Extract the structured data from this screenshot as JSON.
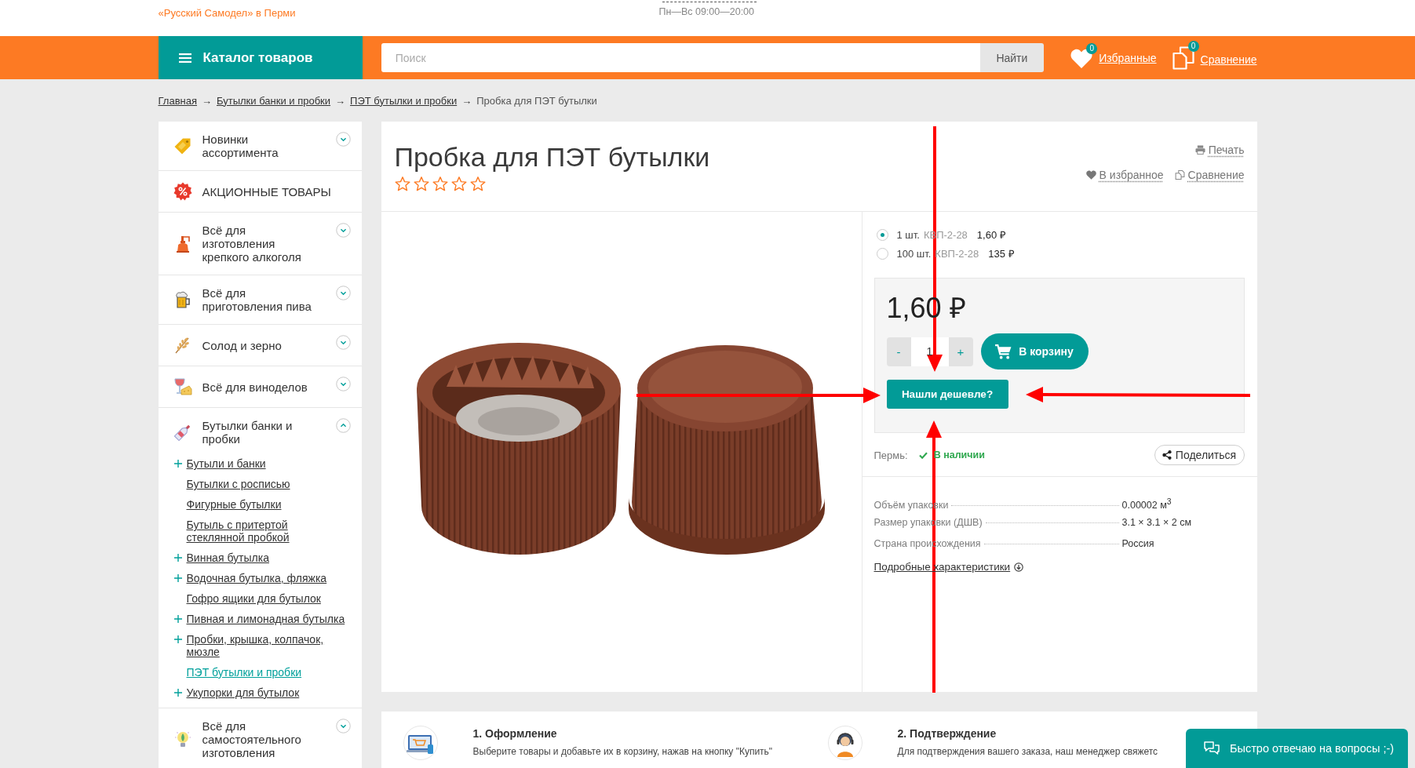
{
  "header": {
    "tagline": "«Русский Самодел» в Перми",
    "hours": "Пн—Вс 09:00—20:00"
  },
  "navbar": {
    "catalog_button": "Каталог товаров",
    "search": {
      "placeholder": "Поиск",
      "button": "Найти"
    },
    "favorites": {
      "label": "Избранные",
      "count": "0"
    },
    "compare": {
      "label": "Сравнение",
      "count": "0"
    }
  },
  "breadcrumb": [
    {
      "label": "Главная",
      "kind": "link",
      "separator": "→"
    },
    {
      "label": "Бутылки банки и пробки",
      "kind": "link",
      "separator": "→"
    },
    {
      "label": "ПЭТ бутылки и пробки",
      "kind": "link",
      "separator": "→"
    },
    {
      "label": "Пробка для ПЭТ бутылки",
      "kind": "current"
    }
  ],
  "sidebar": {
    "items": [
      {
        "label": "Новинки ассортимента",
        "kind": "category",
        "expanded": false
      },
      {
        "label": "АКЦИОННЫЕ ТОВАРЫ",
        "kind": "promo"
      },
      {
        "label": "Всё для изготовления крепкого алкоголя",
        "kind": "category",
        "expanded": false
      },
      {
        "label": "Всё для приготовления пива",
        "kind": "category",
        "expanded": false
      },
      {
        "label": "Солод и зерно",
        "kind": "category",
        "expanded": false
      },
      {
        "label": "Всё для виноделов",
        "kind": "category",
        "expanded": false
      },
      {
        "label": "Бутылки банки и пробки",
        "kind": "category",
        "expanded": true,
        "children": [
          {
            "label": "Бутыли и банки",
            "has_children": true,
            "selected": false
          },
          {
            "label": "Бутылки с росписью",
            "has_children": false,
            "selected": false
          },
          {
            "label": "Фигурные бутылки",
            "has_children": false,
            "selected": false
          },
          {
            "label": "Бутыль с притертой стеклянной пробкой",
            "has_children": false,
            "selected": false
          },
          {
            "label": "Винная бутылка",
            "has_children": true,
            "selected": false
          },
          {
            "label": "Водочная бутылка, фляжка",
            "has_children": true,
            "selected": false
          },
          {
            "label": "Гофро ящики для бутылок",
            "has_children": false,
            "selected": false
          },
          {
            "label": "Пивная и лимонадная бутылка",
            "has_children": true,
            "selected": false
          },
          {
            "label": "Пробки, крышка, колпачок, мюзле",
            "has_children": true,
            "selected": false
          },
          {
            "label": "ПЭТ бутылки и пробки",
            "has_children": false,
            "selected": true
          },
          {
            "label": "Укупорки для бутылок",
            "has_children": true,
            "selected": false
          }
        ]
      },
      {
        "label": "Всё для самостоятельного изготовления",
        "kind": "category",
        "expanded": false
      }
    ]
  },
  "product": {
    "title": "Пробка для ПЭТ бутылки",
    "stars": 0,
    "actions": [
      {
        "label": "Печать"
      },
      {
        "label": "В избранное"
      },
      {
        "label": "Сравнение"
      }
    ],
    "options": [
      {
        "quantity": "1 шт.",
        "code": "КВП-2-28",
        "price": "1,60 ₽",
        "selected": true
      },
      {
        "quantity": "100 шт.",
        "code": "КВП-2-28",
        "price": "135 ₽",
        "selected": false
      }
    ],
    "price": "1,60 ₽",
    "quantity": {
      "minus": "-",
      "value": "1",
      "plus": "+"
    },
    "cart_button": "В корзину",
    "cheaper_button": "Нашли дешевле?",
    "availability": {
      "city": "Пермь:",
      "status": "В наличии",
      "in_stock": true
    },
    "share_button": "Поделиться",
    "specs": [
      {
        "label": "Объём упаковки",
        "value": "0.00002 м$^{3}$"
      },
      {
        "label": "Размер упаковки (ДШВ)",
        "value": "3.1 × 3.1 × 2 см"
      },
      {
        "label": "Страна происхождения",
        "value": "Россия"
      }
    ],
    "details_link": "Подробные характеристики"
  },
  "steps": [
    {
      "title": "1. Оформление",
      "text": "Выберите товары и добавьте их в корзину, нажав на кнопку \"Купить\""
    },
    {
      "title": "2. Подтверждение",
      "text": "Для подтверждения вашего заказа, наш менеджер свяжетс"
    }
  ],
  "chat": {
    "label": "Быстро отвечаю на вопросы ;-)"
  }
}
